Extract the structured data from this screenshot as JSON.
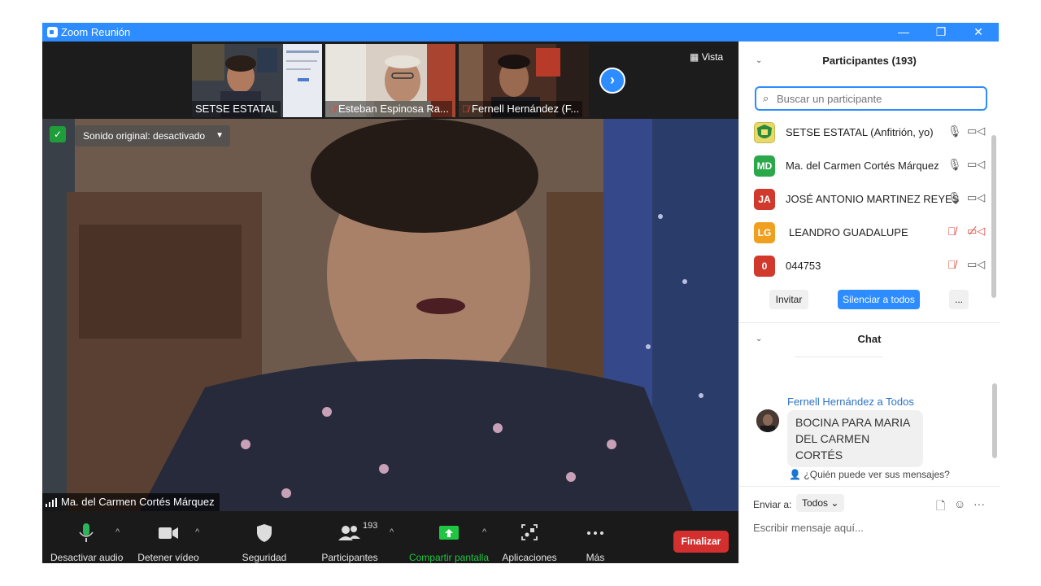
{
  "window": {
    "title": "Zoom Reunión",
    "minimize": "—",
    "restore": "❐",
    "close": "✕"
  },
  "thumbnails": [
    {
      "name": "SETSE ESTATAL",
      "muted": false
    },
    {
      "name": "Esteban Espinosa Ra...",
      "muted": true
    },
    {
      "name": "Fernell Hernández (F...",
      "muted": true
    }
  ],
  "view_button": "Vista",
  "sound_original": "Sonido original: desactivado",
  "active_speaker": "Ma. del Carmen Cortés Márquez",
  "toolbar": {
    "mute_audio": "Desactivar audio",
    "stop_video": "Detener vídeo",
    "security": "Seguridad",
    "participants": "Participantes",
    "participants_count": "193",
    "share_screen": "Compartir pantalla",
    "apps": "Aplicaciones",
    "more": "Más",
    "end": "Finalizar"
  },
  "participants_panel": {
    "title": "Participantes (193)",
    "search_placeholder": "Buscar un participante",
    "items": [
      {
        "initials": "",
        "name": "SETSE ESTATAL (Anfitrión, yo)",
        "color": "#e9d86a",
        "mic_off": false,
        "cam_off": false
      },
      {
        "initials": "MD",
        "name": "Ma. del Carmen Cortés Márquez",
        "color": "#2aa84a",
        "mic_off": false,
        "cam_off": false
      },
      {
        "initials": "JA",
        "name": "JOSÉ ANTONIO MARTINEZ REYES",
        "color": "#d0392b",
        "mic_off": false,
        "cam_off": false
      },
      {
        "initials": "LG",
        "name": "LEANDRO GUADALUPE",
        "color": "#f0a020",
        "mic_off": true,
        "cam_off": true
      },
      {
        "initials": "0",
        "name": "044753",
        "color": "#d0392b",
        "mic_off": true,
        "cam_off": false
      }
    ],
    "invite": "Invitar",
    "mute_all": "Silenciar a todos",
    "more": "..."
  },
  "chat_panel": {
    "title": "Chat",
    "message": {
      "sender": "Fernell Hernández a Todos",
      "text": "BOCINA PARA MARIA DEL CARMEN CORTÉS"
    },
    "who_sees": "¿Quién puede ver sus mensajes?",
    "send_to_label": "Enviar a:",
    "send_to_value": "Todos",
    "input_placeholder": "Escribir mensaje aquí..."
  },
  "colors": {
    "accent": "#2d8cff",
    "end": "#d32f2f",
    "share": "#1fc642"
  }
}
